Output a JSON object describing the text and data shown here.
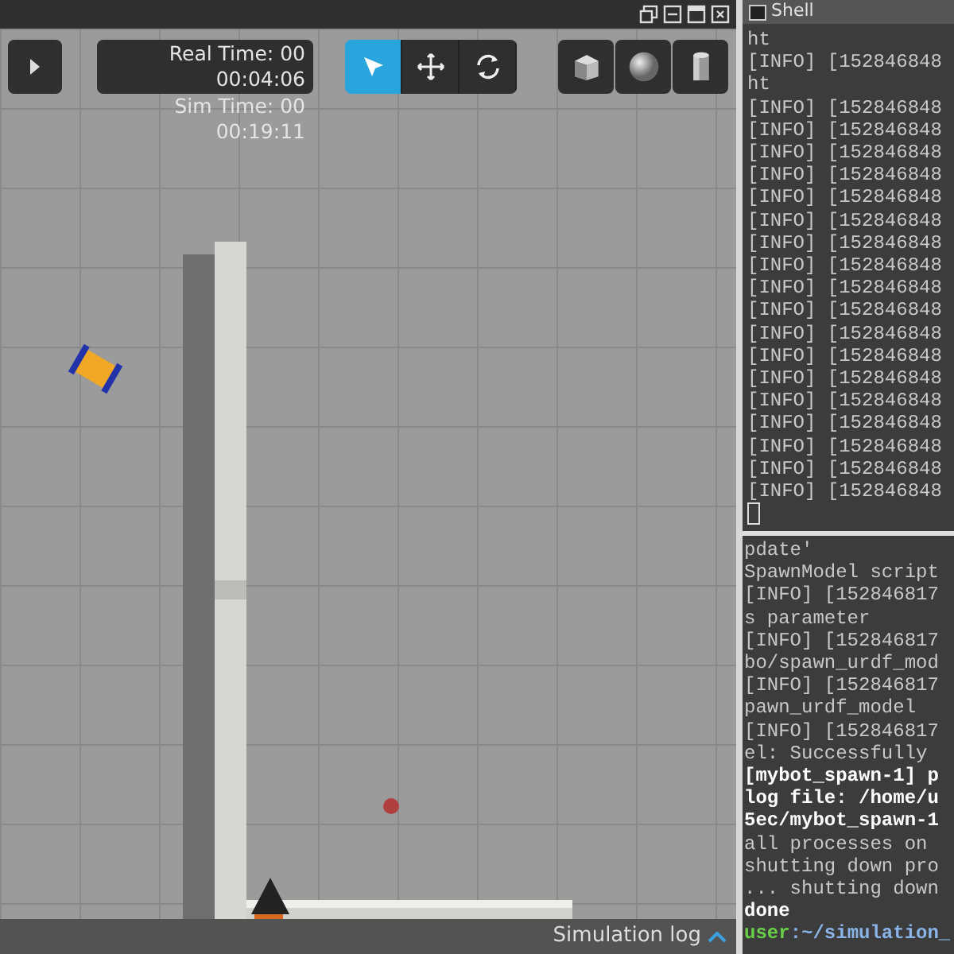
{
  "viewer": {
    "toolbar": {
      "time": {
        "real_label": "Real Time: 00",
        "real_value": "00:04:06",
        "sim_label": "Sim Time: 00",
        "sim_value": "00:19:11"
      },
      "modes": [
        {
          "kind": "select",
          "selected": true
        },
        {
          "kind": "translate",
          "selected": false
        },
        {
          "kind": "rotate",
          "selected": false
        }
      ],
      "shapes": [
        {
          "kind": "box"
        },
        {
          "kind": "sphere"
        },
        {
          "kind": "cylinder"
        }
      ]
    },
    "log_bar": {
      "label": "Simulation log"
    }
  },
  "shell": {
    "title": "Shell",
    "upper_lines": [
      "ht",
      "[INFO] [152846848",
      "ht",
      "[INFO] [152846848",
      "[INFO] [152846848",
      "[INFO] [152846848",
      "[INFO] [152846848",
      "[INFO] [152846848",
      "[INFO] [152846848",
      "[INFO] [152846848",
      "[INFO] [152846848",
      "[INFO] [152846848",
      "[INFO] [152846848",
      "[INFO] [152846848",
      "[INFO] [152846848",
      "[INFO] [152846848",
      "[INFO] [152846848",
      "[INFO] [152846848",
      "[INFO] [152846848",
      "[INFO] [152846848",
      "[INFO] [152846848"
    ],
    "lower_lines": [
      {
        "kind": "normal",
        "text": "pdate'"
      },
      {
        "kind": "normal",
        "text": "SpawnModel script"
      },
      {
        "kind": "normal",
        "text": "[INFO] [152846817"
      },
      {
        "kind": "normal",
        "text": "s parameter"
      },
      {
        "kind": "normal",
        "text": "[INFO] [152846817"
      },
      {
        "kind": "normal",
        "text": "bo/spawn_urdf_mod"
      },
      {
        "kind": "normal",
        "text": "[INFO] [152846817"
      },
      {
        "kind": "normal",
        "text": "pawn_urdf_model"
      },
      {
        "kind": "normal",
        "text": "[INFO] [152846817"
      },
      {
        "kind": "normal",
        "text": "el: Successfully"
      },
      {
        "kind": "bold",
        "text": "[mybot_spawn-1] p"
      },
      {
        "kind": "bold",
        "text": "log file: /home/u"
      },
      {
        "kind": "bold",
        "text": "5ec/mybot_spawn-1"
      },
      {
        "kind": "normal",
        "text": "all processes on"
      },
      {
        "kind": "normal",
        "text": "shutting down pro"
      },
      {
        "kind": "normal",
        "text": "... shutting down"
      },
      {
        "kind": "bold",
        "text": "done"
      },
      {
        "kind": "prompt",
        "user": "user",
        "text": ":~/simulation_"
      }
    ]
  }
}
